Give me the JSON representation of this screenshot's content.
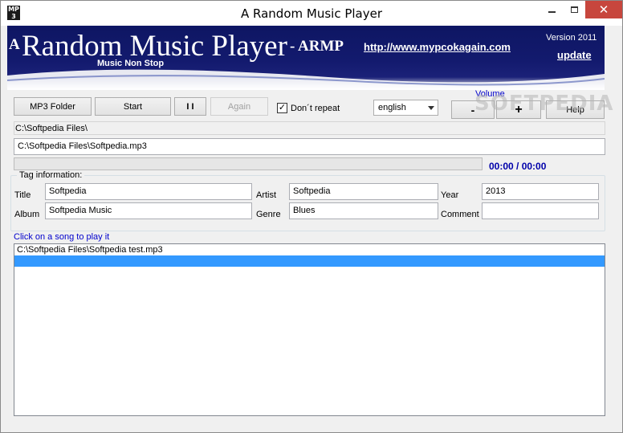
{
  "window": {
    "title": "A Random Music Player",
    "icon_text_top": "MP",
    "icon_text_bottom": "3",
    "minimize_label": "",
    "close_label": "✕"
  },
  "banner": {
    "a_letter": "A",
    "title": "Random Music Player",
    "armp": "- ARMP",
    "subtitle": "Music Non Stop",
    "url": "http://www.mypcokagain.com",
    "version": "Version 2011",
    "update": "update"
  },
  "toolbar": {
    "mp3_folder": "MP3 Folder",
    "start": "Start",
    "pause": "I I",
    "again": "Again",
    "dont_repeat": "Don´t repeat",
    "dont_repeat_checked": true,
    "language": "english",
    "volume_label": "Volume",
    "vol_down": "-",
    "vol_up": "+",
    "help": "Help"
  },
  "paths": {
    "folder": "C:\\Softpedia Files\\",
    "file": "C:\\Softpedia Files\\Softpedia.mp3"
  },
  "playback": {
    "progress_fraction": 0,
    "time": "00:00 / 00:00"
  },
  "tags": {
    "group_label": "Tag information:",
    "title_label": "Title",
    "title_value": "Softpedia",
    "artist_label": "Artist",
    "artist_value": "Softpedia",
    "year_label": "Year",
    "year_value": "2013",
    "album_label": "Album",
    "album_value": "Softpedia Music",
    "genre_label": "Genre",
    "genre_value": "Blues",
    "comment_label": "Comment",
    "comment_value": ""
  },
  "playlist": {
    "hint": "Click on a song to play it",
    "items": [
      {
        "text": "C:\\Softpedia Files\\Softpedia test.mp3",
        "selected": false
      },
      {
        "text": "",
        "selected": true
      }
    ]
  },
  "watermark": "SOFTPEDIA",
  "colors": {
    "banner_bg": "#131a6e",
    "link_blue": "#0000cc",
    "time_blue": "#0000aa",
    "selection": "#3399ff",
    "close_red": "#c7463d"
  }
}
